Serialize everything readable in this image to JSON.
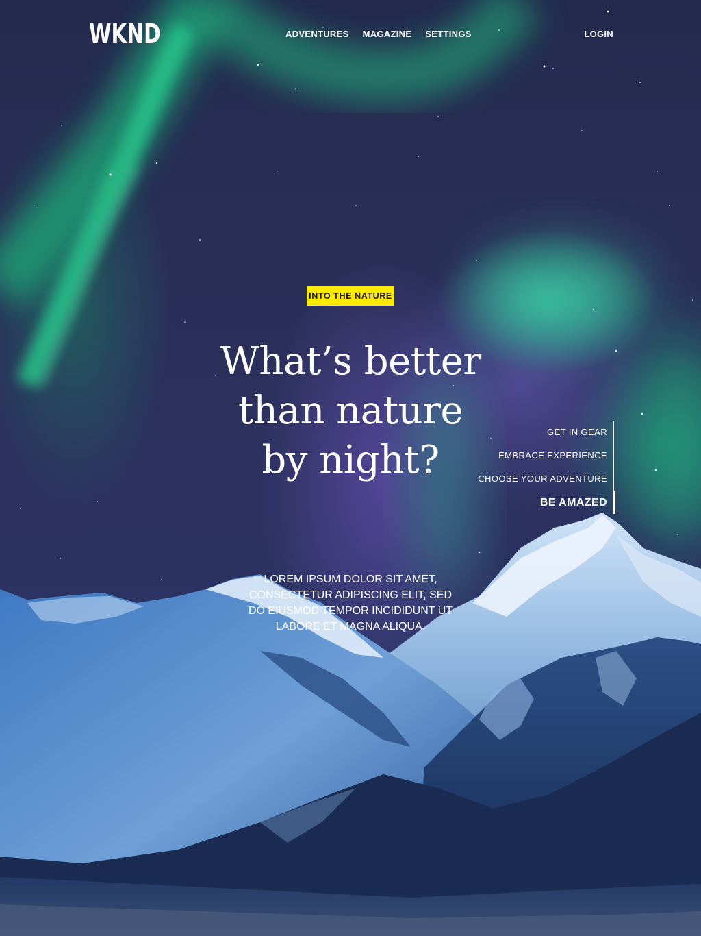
{
  "brand": {
    "logo_text": "WKND"
  },
  "nav": {
    "items": [
      {
        "label": "ADVENTURES"
      },
      {
        "label": "MAGAZINE"
      },
      {
        "label": "SETTINGS"
      }
    ],
    "login_label": "LOGIN"
  },
  "hero": {
    "tag": "INTO THE NATURE",
    "title": "What’s better than nature by night?",
    "text": "LOREM IPSUM DOLOR SIT AMET, CONSECTETUR ADIPISCING ELIT, SED DO EIUSMOD TEMPOR INCIDIDUNT UT LABORE ET MAGNA ALIQUA."
  },
  "steps": {
    "items": [
      {
        "label": "GET IN GEAR"
      },
      {
        "label": "EMBRACE EXPERIENCE"
      },
      {
        "label": "CHOOSE YOUR ADVENTURE"
      },
      {
        "label": "BE AMAZED"
      }
    ],
    "active_index": 3
  },
  "colors": {
    "accent_yellow": "#ffea00",
    "sky": "#2a2f58",
    "aurora": "#2fd19a",
    "text": "#ffffff"
  }
}
